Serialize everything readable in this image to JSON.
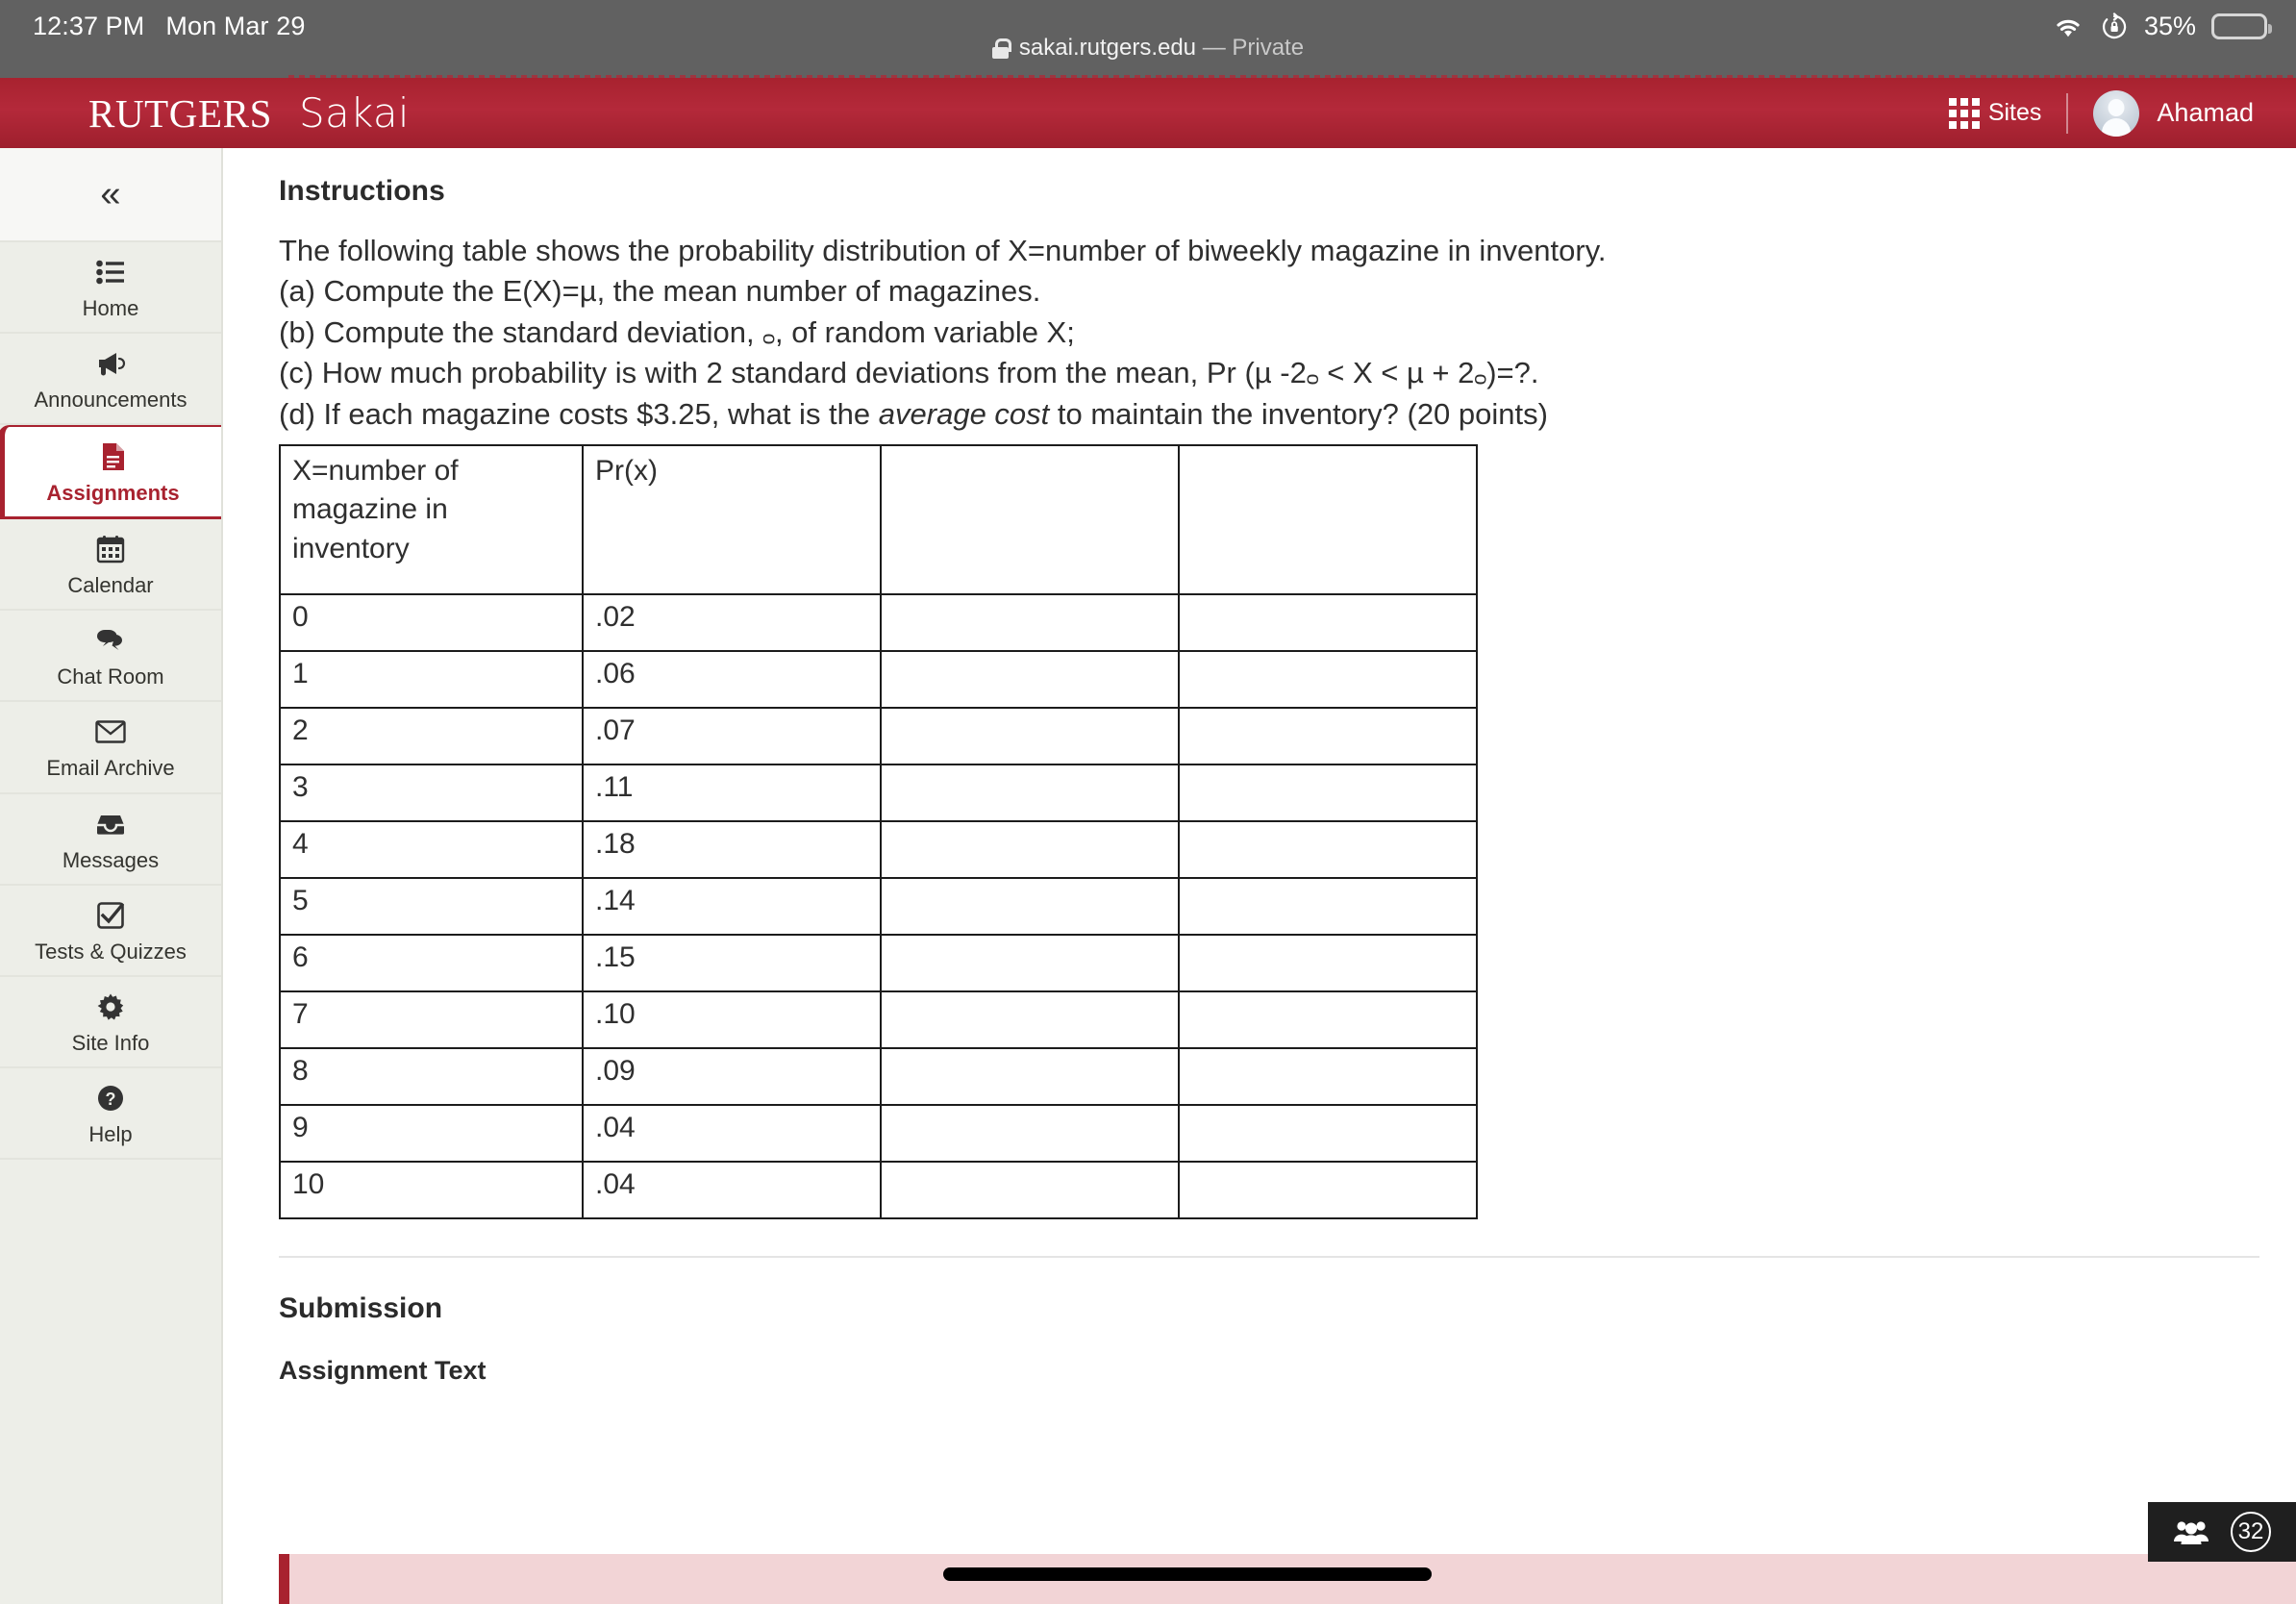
{
  "status_bar": {
    "time": "12:37 PM",
    "date": "Mon Mar 29",
    "url": "sakai.rutgers.edu",
    "url_suffix": "— Private",
    "battery_percent": "35%",
    "battery_level": 35,
    "wifi_icon": "wifi-icon",
    "rotation_lock_icon": "rotation-lock-icon",
    "lock_icon": "lock-icon"
  },
  "header": {
    "brand_primary": "RUTGERS",
    "brand_secondary": "Sakai",
    "sites_label": "Sites",
    "sites_icon": "grid-icon",
    "user_name": "Ahamad",
    "avatar_icon": "avatar",
    "accent_color": "#a8222f"
  },
  "sidebar": {
    "collapse_icon": "«",
    "items": [
      {
        "label": "Home",
        "icon": "list-icon",
        "active": false
      },
      {
        "label": "Announcements",
        "icon": "megaphone-icon",
        "active": false
      },
      {
        "label": "Assignments",
        "icon": "document-icon",
        "active": true
      },
      {
        "label": "Calendar",
        "icon": "calendar-icon",
        "active": false
      },
      {
        "label": "Chat Room",
        "icon": "chat-bubbles-icon",
        "active": false
      },
      {
        "label": "Email Archive",
        "icon": "envelope-icon",
        "active": false
      },
      {
        "label": "Messages",
        "icon": "inbox-icon",
        "active": false
      },
      {
        "label": "Tests & Quizzes",
        "icon": "checkbox-icon",
        "active": false
      },
      {
        "label": "Site Info",
        "icon": "gear-icon",
        "active": false
      },
      {
        "label": "Help",
        "icon": "question-circle-icon",
        "active": false
      }
    ]
  },
  "main": {
    "instructions_title": "Instructions",
    "intro": "The following table shows the probability distribution of X=number of biweekly magazine in inventory.",
    "question_a": "(a) Compute the E(X)=µ, the mean number of magazines.",
    "question_b_pre": "(b)  Compute the standard deviation, ",
    "question_b_sigma": "ᴑ",
    "question_b_post": ", of random variable X;",
    "question_c_pre": " (c) How much probability is with 2 standard deviations from the mean, Pr (µ -2",
    "question_c_sigma1": "ᴑ",
    "question_c_mid": " < X < µ + 2",
    "question_c_sigma2": "ᴑ",
    "question_c_post": ")=?.",
    "question_d_pre": "(d) If each magazine costs $3.25, what is the ",
    "question_d_italic": "average cost",
    "question_d_post": " to maintain the inventory? (20 points)",
    "submission_title": "Submission",
    "assignment_text_title": "Assignment Text"
  },
  "table": {
    "headers": [
      "X=number of magazine in inventory",
      "Pr(x)",
      "",
      ""
    ],
    "rows": [
      [
        "0",
        ".02",
        "",
        ""
      ],
      [
        "1",
        ".06",
        "",
        ""
      ],
      [
        "2",
        ".07",
        "",
        ""
      ],
      [
        "3",
        ".11",
        "",
        ""
      ],
      [
        "4",
        ".18",
        "",
        ""
      ],
      [
        "5",
        ".14",
        "",
        ""
      ],
      [
        "6",
        ".15",
        "",
        ""
      ],
      [
        "7",
        ".10",
        "",
        ""
      ],
      [
        "8",
        ".09",
        "",
        ""
      ],
      [
        "9",
        ".04",
        "",
        ""
      ],
      [
        "10",
        ".04",
        "",
        ""
      ]
    ]
  },
  "float_widget": {
    "people_icon": "people-icon",
    "count": "32"
  }
}
